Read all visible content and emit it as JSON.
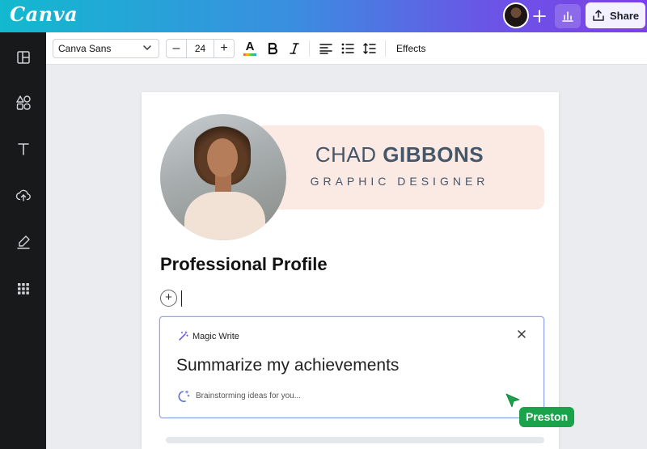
{
  "header": {
    "logo": "Canva",
    "share_label": "Share"
  },
  "toolbar": {
    "font": "Canva Sans",
    "font_size": "24",
    "effects_label": "Effects",
    "minus": "–",
    "plus": "+"
  },
  "design": {
    "name_first": "CHAD ",
    "name_last": "GIBBONS",
    "role": "GRAPHIC DESIGNER",
    "section_title": "Professional Profile"
  },
  "magic_write": {
    "title": "Magic Write",
    "prompt": "Summarize my achievements",
    "status": "Brainstorming ideas for you..."
  },
  "collaborator": {
    "name": "Preston",
    "color": "#1aa34a"
  },
  "colors": {
    "header_gradient_start": "#12b9cf",
    "header_gradient_end": "#7d3fe8",
    "sidebar": "#18191b",
    "banner": "#fbe9e3",
    "name_text": "#44576a"
  }
}
